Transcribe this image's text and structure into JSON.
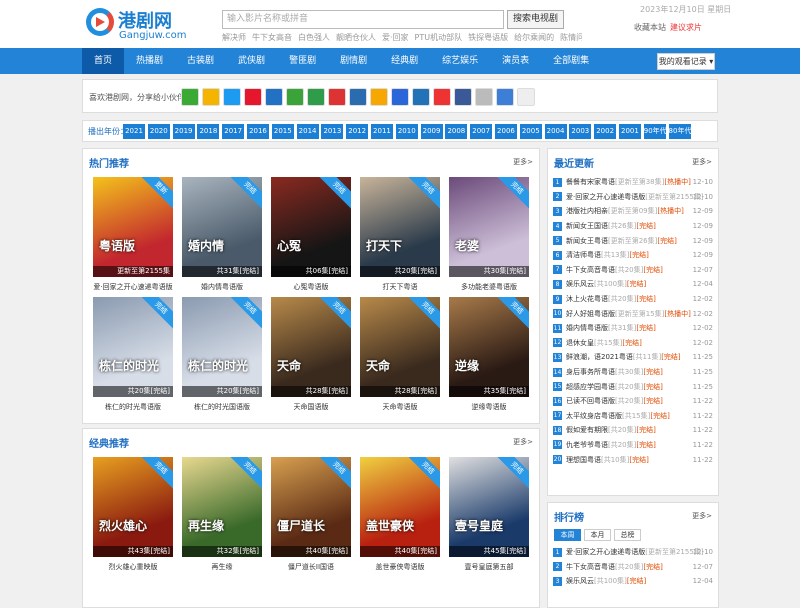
{
  "logo": {
    "cn": "港剧网",
    "en": "Gangjuw.com"
  },
  "search": {
    "placeholder": "输入影片名称或拼音",
    "button": "搜索电视剧"
  },
  "hotwords": [
    "解决师",
    "牛下女高音",
    "白色强人",
    "靓晒仓伙人",
    "爱·回家",
    "PTU机动部队",
    "铁探粤语版",
    "给尔乘闻的",
    "陈情问",
    "将老活今个大老子"
  ],
  "date": "2023年12月10日 星期日",
  "fav": {
    "label": "收藏本站",
    "link": "建议求片"
  },
  "nav": {
    "items": [
      "首页",
      "热播剧",
      "古装剧",
      "武侠剧",
      "警匪剧",
      "剧情剧",
      "经典剧",
      "综艺娱乐",
      "演员表",
      "全部剧集"
    ],
    "history": "我的观看记录"
  },
  "share": {
    "label": "喜欢港剧网，分享给小伙伴们：",
    "icons": [
      "wechat-icon",
      "qzone-icon",
      "qq-icon",
      "weibo-icon",
      "renren-icon",
      "kaixin-icon",
      "douban-icon",
      "renmin-icon",
      "tieba-icon",
      "sohu-icon",
      "baidu-icon",
      "anchor-icon",
      "star-icon",
      "facebook-icon",
      "copy-icon",
      "plus-icon",
      "blank-icon"
    ]
  },
  "years": {
    "label": "播出年份：",
    "items": [
      "2021",
      "2020",
      "2019",
      "2018",
      "2017",
      "2016",
      "2015",
      "2014",
      "2013",
      "2012",
      "2011",
      "2010",
      "2009",
      "2008",
      "2007",
      "2006",
      "2005",
      "2004",
      "2003",
      "2002",
      "2001",
      "90年代",
      "80年代"
    ]
  },
  "hot": {
    "title": "热门推荐",
    "more": "更多>",
    "items": [
      {
        "title": "爱·回家之开心速递粤语版",
        "ep": "更新至第2155集",
        "badge": "更新",
        "color": "#c2262e",
        "color2": "#f4c21c",
        "text": "粤语版"
      },
      {
        "title": "婚内情粤语版",
        "ep": "共31集[完结]",
        "badge": "完结",
        "color": "#4a5a6a",
        "color2": "#a9b4be",
        "text": "婚内情"
      },
      {
        "title": "心冤粤语版",
        "ep": "共06集[完结]",
        "badge": "完结",
        "color": "#151515",
        "color2": "#8a2a20",
        "text": "心冤"
      },
      {
        "title": "打天下粤语",
        "ep": "共20集[完结]",
        "badge": "完结",
        "color": "#2a3a4a",
        "color2": "#c8b49a",
        "text": "打天下"
      },
      {
        "title": "多功能老婆粤语版",
        "ep": "共30集[完结]",
        "badge": "完结",
        "color": "#cdbfd8",
        "color2": "#6b4a7a",
        "text": "老婆"
      },
      {
        "title": "栋仁的时光粤语版",
        "ep": "共20集[完结]",
        "badge": "完结",
        "color": "#d8dee8",
        "color2": "#8a9ab0",
        "text": "栋仁的时光"
      },
      {
        "title": "栋仁的时光国语版",
        "ep": "共20集[完结]",
        "badge": "完结",
        "color": "#d8dee8",
        "color2": "#8a9ab0",
        "text": "栋仁的时光"
      },
      {
        "title": "天命国语版",
        "ep": "共28集[完结]",
        "badge": "完结",
        "color": "#3a2a1e",
        "color2": "#b88a4a",
        "text": "天命"
      },
      {
        "title": "天命粤语版",
        "ep": "共28集[完结]",
        "badge": "完结",
        "color": "#3a2a1e",
        "color2": "#b88a4a",
        "text": "天命"
      },
      {
        "title": "逆缘粤语版",
        "ep": "共35集[完结]",
        "badge": "完结",
        "color": "#2a1a14",
        "color2": "#a87a4a",
        "text": "逆缘"
      }
    ]
  },
  "classic": {
    "title": "经典推荐",
    "more": "更多>",
    "items": [
      {
        "title": "烈火雄心重映版",
        "ep": "共43集[完结]",
        "badge": "完结",
        "color": "#8a1a10",
        "color2": "#e8a020",
        "text": "烈火雄心"
      },
      {
        "title": "再生缘",
        "ep": "共32集[完结]",
        "badge": "完结",
        "color": "#3a6a2a",
        "color2": "#e8d890",
        "text": "再生缘"
      },
      {
        "title": "僵尸道长II国语",
        "ep": "共40集[完结]",
        "badge": "完结",
        "color": "#5a2a14",
        "color2": "#d8a050",
        "text": "僵尸道长"
      },
      {
        "title": "盖世豪侠粤语版",
        "ep": "共40集[完结]",
        "badge": "完结",
        "color": "#b82010",
        "color2": "#f0d040",
        "text": "盖世豪侠"
      },
      {
        "title": "壹号皇庭第五部",
        "ep": "共45集[完结]",
        "badge": "完结",
        "color": "#1a3a6a",
        "color2": "#e0e0e0",
        "text": "壹号皇庭"
      }
    ]
  },
  "latest": {
    "title": "最近更新",
    "more": "更多>",
    "items": [
      {
        "title": "餐餐有宋家粤语",
        "info": "更新至第38集",
        "stat": "[热播中]",
        "date": "12-10"
      },
      {
        "title": "爱·回家之开心速递粤语版",
        "info": "更新至第2155集",
        "stat": "",
        "date": "12-10"
      },
      {
        "title": "港版社内相亲",
        "info": "更新至第09集",
        "stat": "[热播中]",
        "date": "12-09"
      },
      {
        "title": "新闻女王国语",
        "info": "共26集",
        "stat": "[完结]",
        "date": "12-09"
      },
      {
        "title": "新闻女王粤语",
        "info": "更新至第26集",
        "stat": "[完结]",
        "date": "12-09"
      },
      {
        "title": "清洁师粤语",
        "info": "共13集",
        "stat": "[完结]",
        "date": "12-09"
      },
      {
        "title": "牛下女高音粤语",
        "info": "共20集",
        "stat": "[完结]",
        "date": "12-07"
      },
      {
        "title": "娱乐风云",
        "info": "共100集",
        "stat": "[完结]",
        "date": "12-04"
      },
      {
        "title": "沐上火花粤语",
        "info": "共20集",
        "stat": "[完结]",
        "date": "12-02"
      },
      {
        "title": "好人好姐粤语版",
        "info": "更新至第15集",
        "stat": "[热播中]",
        "date": "12-02"
      },
      {
        "title": "婚内情粤语版",
        "info": "共31集",
        "stat": "[完结]",
        "date": "12-02"
      },
      {
        "title": "退休女皇",
        "info": "共15集",
        "stat": "[完结]",
        "date": "12-02"
      },
      {
        "title": "鲜浪潮，语2021粤语",
        "info": "共11集",
        "stat": "[完结]",
        "date": "11-25"
      },
      {
        "title": "身后事务所粤语",
        "info": "共30集",
        "stat": "[完结]",
        "date": "11-25"
      },
      {
        "title": "超感应学园粤语",
        "info": "共20集",
        "stat": "[完结]",
        "date": "11-25"
      },
      {
        "title": "已读不回粤语版",
        "info": "共20集",
        "stat": "[完结]",
        "date": "11-22"
      },
      {
        "title": "太平纹身店粤语版",
        "info": "共15集",
        "stat": "[完结]",
        "date": "11-22"
      },
      {
        "title": "假如爱有期限",
        "info": "共20集",
        "stat": "[完结]",
        "date": "11-22"
      },
      {
        "title": "仇老爷爷粤语",
        "info": "共20集",
        "stat": "[完结]",
        "date": "11-22"
      },
      {
        "title": "理想国粤语",
        "info": "共10集",
        "stat": "[完结]",
        "date": "11-22"
      }
    ]
  },
  "ranking": {
    "title": "排行榜",
    "more": "更多>",
    "tabs": [
      "本周",
      "本月",
      "总榜"
    ],
    "items": [
      {
        "title": "爱·回家之开心速递粤语版",
        "info": "更新至第2155集",
        "stat": "",
        "date": "12-10"
      },
      {
        "title": "牛下女高音粤语",
        "info": "共20集",
        "stat": "[完结]",
        "date": "12-07"
      },
      {
        "title": "娱乐风云",
        "info": "共100集",
        "stat": "[完结]",
        "date": "12-04"
      }
    ]
  }
}
